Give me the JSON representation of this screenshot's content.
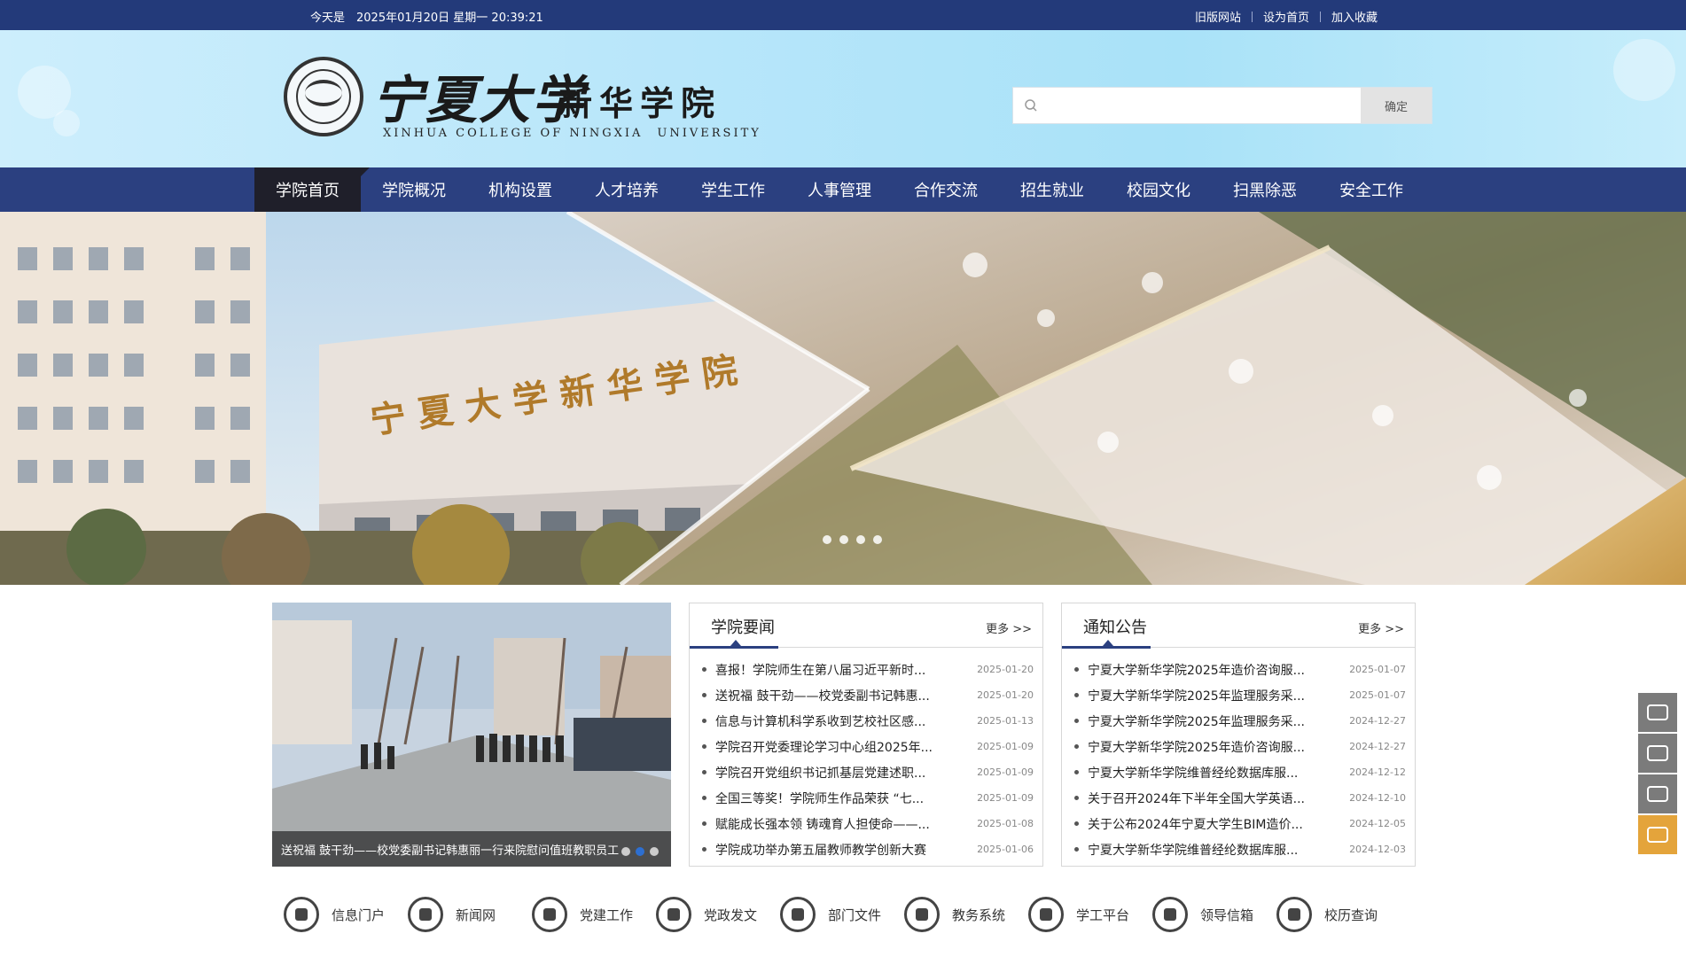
{
  "topbar": {
    "date_text": "今天是　2025年01月20日 星期一 20:39:21",
    "links": [
      "旧版网站",
      "设为首页",
      "加入收藏"
    ]
  },
  "header": {
    "brand_script": "宁夏大学",
    "brand_name": "新华学院",
    "brand_en": "XINHUA COLLEGE OF NINGXIA　UNIVERSITY",
    "search_placeholder": "",
    "search_button": "确定"
  },
  "nav": {
    "items": [
      "学院首页",
      "学院概况",
      "机构设置",
      "人才培养",
      "学生工作",
      "人事管理",
      "合作交流",
      "招生就业",
      "校园文化",
      "扫黑除恶",
      "安全工作"
    ],
    "active_index": 0
  },
  "banner": {
    "building_sign": "宁 夏 大 学 新 华 学 院",
    "slide_count": 4
  },
  "photo": {
    "caption": "送祝福 鼓干劲——校党委副书记韩惠丽一行来院慰问值班教职员工"
  },
  "news": {
    "title": "学院要闻",
    "more": "更多 >>",
    "items": [
      {
        "text": "喜报！学院师生在第八届习近平新时...",
        "date": "2025-01-20"
      },
      {
        "text": "送祝福 鼓干劲——校党委副书记韩惠...",
        "date": "2025-01-20"
      },
      {
        "text": "信息与计算机科学系收到艺校社区感...",
        "date": "2025-01-13"
      },
      {
        "text": "学院召开党委理论学习中心组2025年...",
        "date": "2025-01-09"
      },
      {
        "text": "学院召开党组织书记抓基层党建述职...",
        "date": "2025-01-09"
      },
      {
        "text": "全国三等奖！学院师生作品荣获 “七...",
        "date": "2025-01-09"
      },
      {
        "text": "赋能成长强本领 铸魂育人担使命——...",
        "date": "2025-01-08"
      },
      {
        "text": "学院成功举办第五届教师教学创新大赛",
        "date": "2025-01-06"
      }
    ]
  },
  "notices": {
    "title": "通知公告",
    "more": "更多 >>",
    "items": [
      {
        "text": "宁夏大学新华学院2025年造价咨询服...",
        "date": "2025-01-07"
      },
      {
        "text": "宁夏大学新华学院2025年监理服务采...",
        "date": "2025-01-07"
      },
      {
        "text": "宁夏大学新华学院2025年监理服务采...",
        "date": "2024-12-27"
      },
      {
        "text": "宁夏大学新华学院2025年造价咨询服...",
        "date": "2024-12-27"
      },
      {
        "text": "宁夏大学新华学院维普经纶数据库服...",
        "date": "2024-12-12"
      },
      {
        "text": "关于召开2024年下半年全国大学英语...",
        "date": "2024-12-10"
      },
      {
        "text": "关于公布2024年宁夏大学生BIM造价...",
        "date": "2024-12-05"
      },
      {
        "text": "宁夏大学新华学院维普经纶数据库服...",
        "date": "2024-12-03"
      }
    ]
  },
  "quick_links": [
    {
      "label": "信息门户",
      "icon": "portal-icon"
    },
    {
      "label": "新闻网",
      "icon": "camera-icon"
    },
    {
      "label": "党建工作",
      "icon": "party-emblem-icon"
    },
    {
      "label": "党政发文",
      "icon": "gear-icon"
    },
    {
      "label": "部门文件",
      "icon": "hands-icon"
    },
    {
      "label": "教务系统",
      "icon": "lock-icon"
    },
    {
      "label": "学工平台",
      "icon": "graduation-cap-icon"
    },
    {
      "label": "领导信箱",
      "icon": "envelope-icon"
    },
    {
      "label": "校历查询",
      "icon": "edit-icon"
    }
  ],
  "side_float": [
    {
      "icon": "wechat-icon"
    },
    {
      "icon": "weibo-icon"
    },
    {
      "icon": "mail-icon"
    },
    {
      "icon": "open-mail-icon"
    }
  ],
  "colors": {
    "topbar": "#233a7a",
    "nav": "#2b4080",
    "nav_active": "#1f1f2a",
    "accent_orange": "#e4a43b"
  }
}
